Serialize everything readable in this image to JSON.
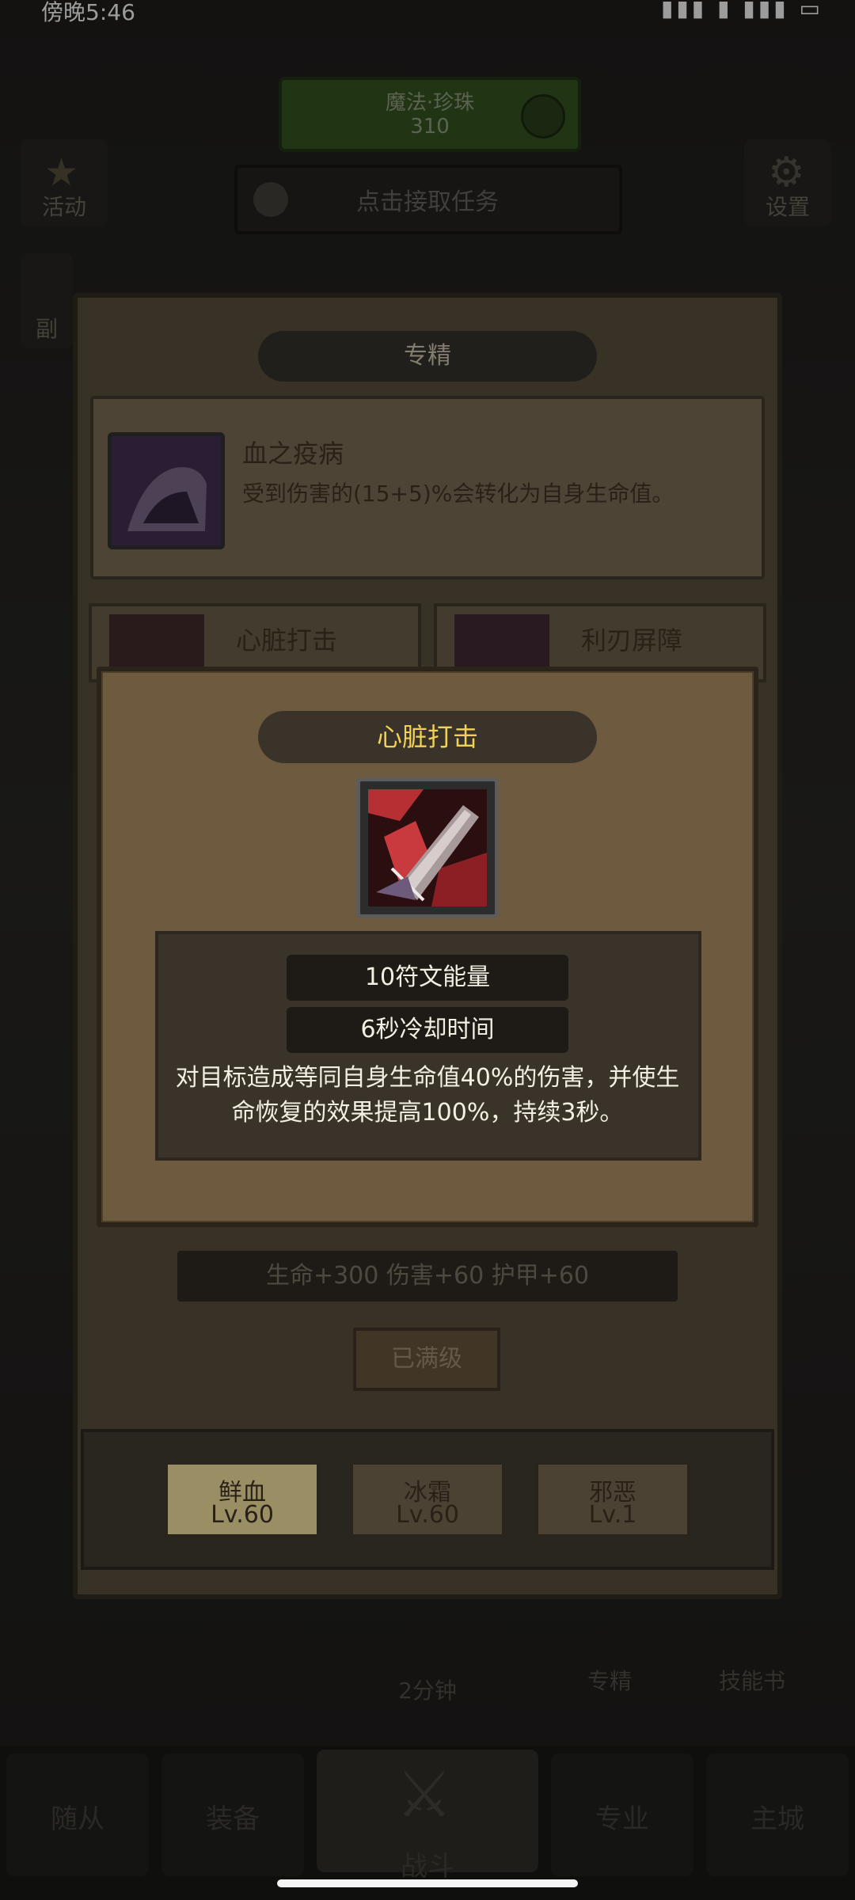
{
  "status_bar": {
    "time": "傍晚5:46",
    "right": "▮▮▮ ▮ ▮▮▮ ▭"
  },
  "background": {
    "top_banner": {
      "line1": "魔法·珍珠",
      "line2": "310"
    },
    "task_bar": {
      "label": "点击接取任务"
    },
    "side_buttons": [
      {
        "label": "活动"
      },
      {
        "label": "副"
      },
      {
        "label": "设置"
      }
    ],
    "lower_shortcuts": [
      {
        "label": "2分钟"
      },
      {
        "label": "专精"
      },
      {
        "label": "技能书"
      }
    ],
    "bottom_nav": [
      {
        "label": "随从"
      },
      {
        "label": "装备"
      },
      {
        "label": "战斗"
      },
      {
        "label": "专业"
      },
      {
        "label": "主城"
      }
    ]
  },
  "panel": {
    "title": "专精",
    "spec": {
      "name": "血之疫病",
      "description": "受到伤害的(15+5)%会转化为自身生命值。"
    },
    "skills": [
      {
        "name": "心脏打击"
      },
      {
        "name": "利刃屏障"
      }
    ],
    "stats": "生命+300  伤害+60  护甲+60",
    "max_button": "已满级",
    "trees": [
      {
        "name": "鲜血",
        "level": "Lv.60",
        "active": true
      },
      {
        "name": "冰霜",
        "level": "Lv.60",
        "active": false
      },
      {
        "name": "邪恶",
        "level": "Lv.1",
        "active": false
      }
    ]
  },
  "popup": {
    "title": "心脏打击",
    "icon": "sword-strike-icon",
    "cost": "10符文能量",
    "cooldown": "6秒冷却时间",
    "description": "对目标造成等同自身生命值40%的伤害，并使生命恢复的效果提高100%，持续3秒。"
  },
  "colors": {
    "popup_title": "#f1d257",
    "popup_bg": "#6e5a3f",
    "active_tree": "#d6c58d"
  }
}
